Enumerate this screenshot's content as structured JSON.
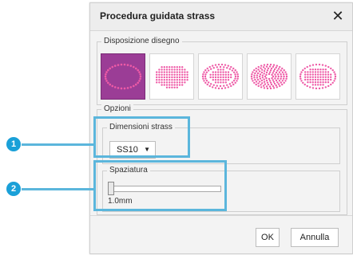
{
  "dialog": {
    "title": "Procedura guidata strass",
    "close_icon": "close-icon",
    "close_glyph": "✕"
  },
  "layout_group": {
    "label": "Disposizione disegno",
    "thumbnails": [
      {
        "name": "outline-oval",
        "selected": true
      },
      {
        "name": "filled-oval",
        "selected": false
      },
      {
        "name": "oval-ring-fill",
        "selected": false
      },
      {
        "name": "oval-concentric",
        "selected": false
      },
      {
        "name": "oval-grid",
        "selected": false
      }
    ]
  },
  "options_group": {
    "label": "Opzioni",
    "size_group": {
      "label": "Dimensioni strass",
      "select_value": "SS10",
      "caret_icon": "caret-down-icon",
      "caret_glyph": "▼"
    },
    "spacing_group": {
      "label": "Spaziatura",
      "value_label": "1.0mm",
      "slider_fraction": 0.0
    }
  },
  "buttons": {
    "ok": "OK",
    "cancel": "Annulla"
  },
  "callouts": [
    {
      "number": "1"
    },
    {
      "number": "2"
    }
  ],
  "colors": {
    "accent": "#9b3d96",
    "dot": "#ee5aa6",
    "callout": "#5bb6dc",
    "badge": "#1aa0d8"
  }
}
